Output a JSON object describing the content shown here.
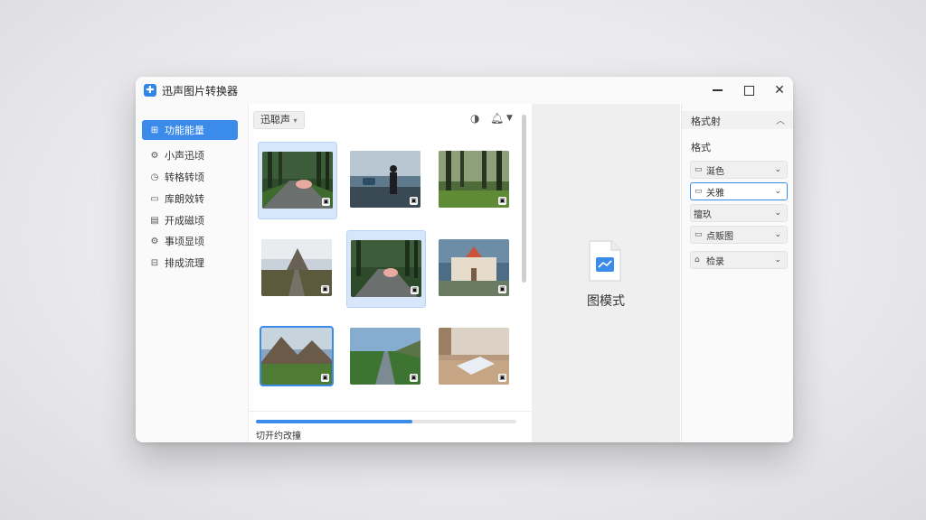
{
  "window": {
    "title": "迅声图片转换器"
  },
  "sidebar": {
    "items": [
      {
        "label": "功能能量",
        "icon": "grid-plus-icon",
        "active": true
      },
      {
        "label": "小声迅顷",
        "icon": "gear-icon",
        "active": false
      },
      {
        "label": "转格转顷",
        "icon": "circle-play-icon",
        "active": false
      },
      {
        "label": "库朗效转",
        "icon": "folder-icon",
        "active": false
      },
      {
        "label": "开成磁顷",
        "icon": "document-icon",
        "active": false
      },
      {
        "label": "事顷显顷",
        "icon": "settings-icon",
        "active": false
      },
      {
        "label": "排成流理",
        "icon": "layout-icon",
        "active": false
      }
    ]
  },
  "gallery": {
    "folder_label": "迅聪声",
    "progress": {
      "fraction": 0.6,
      "label": "切开约改撞"
    }
  },
  "preview": {
    "label": "图模式"
  },
  "options": {
    "header": "格式射",
    "section": "格式",
    "selects": [
      {
        "icon": "image-icon",
        "label": "涎色"
      },
      {
        "icon": "image-icon",
        "label": "关雅"
      },
      {
        "icon": "",
        "label": "擅玖"
      },
      {
        "icon": "image-icon",
        "label": "点贩图"
      },
      {
        "icon": "tag-icon",
        "label": "检录"
      }
    ]
  },
  "colors": {
    "accent": "#3b8beb",
    "selected_bg": "#d7e6fb"
  }
}
